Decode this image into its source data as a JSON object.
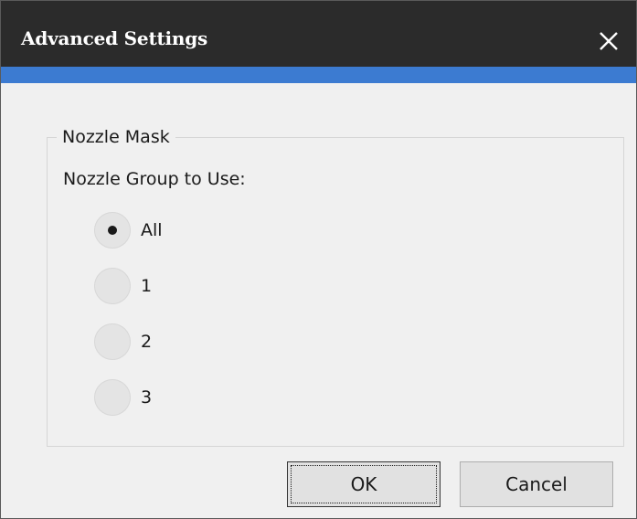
{
  "window": {
    "title": "Advanced Settings",
    "close_icon": "close-icon",
    "accent_color": "#3c7bd1",
    "titlebar_color": "#2b2b2b"
  },
  "nozzle_mask": {
    "group_label": "Nozzle Mask",
    "prompt": "Nozzle Group to Use:",
    "options": [
      {
        "label": "All",
        "selected": true
      },
      {
        "label": "1",
        "selected": false
      },
      {
        "label": "2",
        "selected": false
      },
      {
        "label": "3",
        "selected": false
      }
    ]
  },
  "buttons": {
    "ok_label": "OK",
    "cancel_label": "Cancel"
  }
}
